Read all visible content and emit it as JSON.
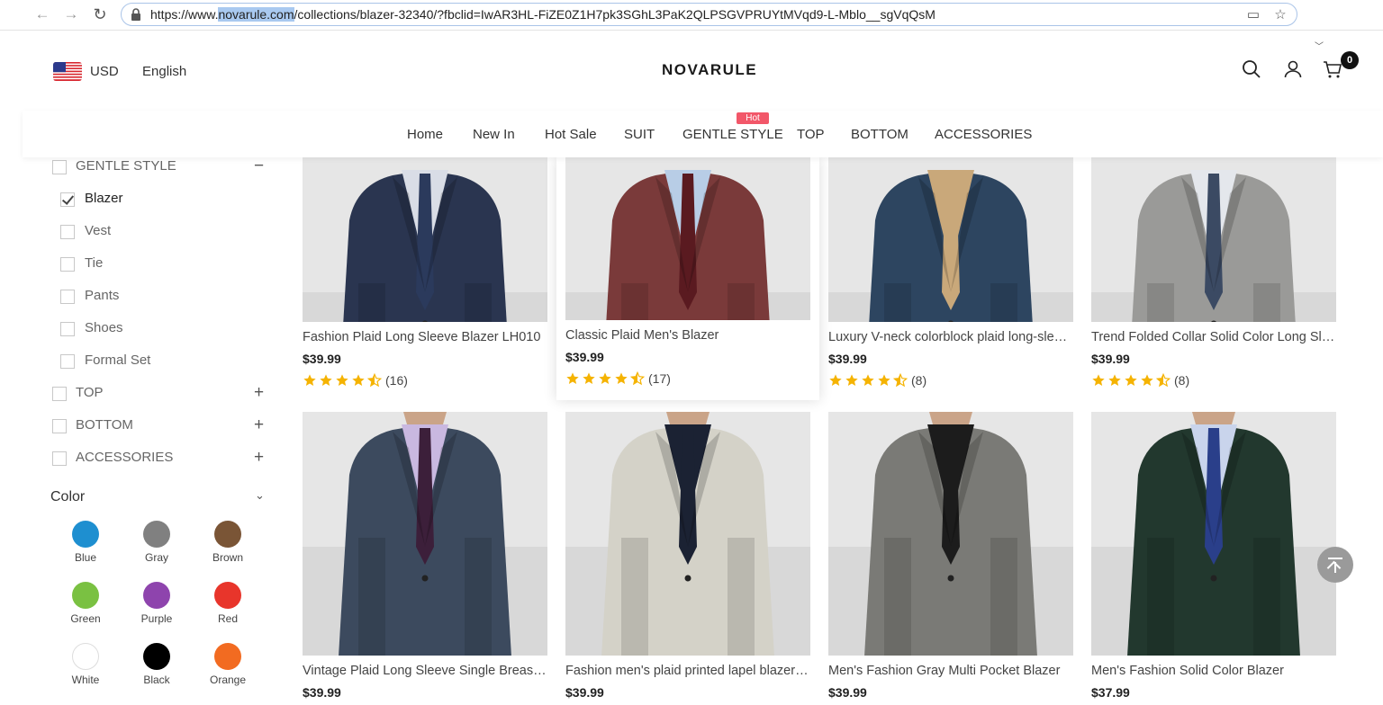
{
  "browser": {
    "url_pre": "https://www.",
    "url_host": "novarule.com",
    "url_post": "/collections/blazer-32340/?fbclid=IwAR3HL-FiZE0Z1H7pk3SGhL3PaK2QLPSGVPRUYtMVqd9-L-Mblo__sgVqQsM"
  },
  "header": {
    "currency": "USD",
    "language": "English",
    "logo": "NOVARULE",
    "cart_count": "0"
  },
  "menu": {
    "items": [
      "Home",
      "New In",
      "Hot Sale",
      "SUIT",
      "GENTLE STYLE",
      "TOP",
      "BOTTOM",
      "ACCESSORIES"
    ],
    "hot_badge": "Hot"
  },
  "sidebar": {
    "categories": [
      {
        "label": "GENTLE STYLE",
        "toggle": "−"
      },
      {
        "label": "Blazer"
      },
      {
        "label": "Vest"
      },
      {
        "label": "Tie"
      },
      {
        "label": "Pants"
      },
      {
        "label": "Shoes"
      },
      {
        "label": "Formal Set"
      },
      {
        "label": "TOP",
        "toggle": "+"
      },
      {
        "label": "BOTTOM",
        "toggle": "+"
      },
      {
        "label": "ACCESSORIES",
        "toggle": "+"
      }
    ],
    "color_title": "Color",
    "colors": [
      {
        "name": "Blue",
        "hex": "#1e8fd0"
      },
      {
        "name": "Gray",
        "hex": "#808080"
      },
      {
        "name": "Brown",
        "hex": "#7a5536"
      },
      {
        "name": "Green",
        "hex": "#7ac142"
      },
      {
        "name": "Purple",
        "hex": "#8e44ad"
      },
      {
        "name": "Red",
        "hex": "#e8352b"
      },
      {
        "name": "White",
        "hex": "#ffffff"
      },
      {
        "name": "Black",
        "hex": "#000000"
      },
      {
        "name": "Orange",
        "hex": "#f26b21"
      }
    ]
  },
  "products": [
    {
      "name": "Fashion Plaid Long Sleeve Blazer LH010",
      "price": "$39.99",
      "reviews": "(16)",
      "rating": 4.5,
      "jacket": "#2a3550",
      "inner": "#d9dde6",
      "tie": "#2b3a5c"
    },
    {
      "name": "Classic Plaid Men's Blazer",
      "price": "$39.99",
      "reviews": "(17)",
      "rating": 4.5,
      "jacket": "#7a3a3a",
      "inner": "#b8cde6",
      "tie": "#5a1a20"
    },
    {
      "name": "Luxury V-neck colorblock plaid long-sleeve blazer",
      "price": "$39.99",
      "reviews": "(8)",
      "rating": 4.5,
      "jacket": "#2d4560",
      "inner": "#c9a87a",
      "tie": "#c9a87a"
    },
    {
      "name": "Trend Folded Collar Solid Color Long Sleeve Blazer",
      "price": "$39.99",
      "reviews": "(8)",
      "rating": 4.5,
      "jacket": "#9a9a98",
      "inner": "#e4e7ec",
      "tie": "#3b4a63"
    },
    {
      "name": "Vintage Plaid Long Sleeve Single Breasted Blazer",
      "price": "$39.99",
      "jacket": "#3c4a5e",
      "inner": "#c9b8e0",
      "tie": "#3c1f3a"
    },
    {
      "name": "Fashion men's plaid printed lapel blazer jacket",
      "price": "$39.99",
      "jacket": "#d4d2c8",
      "inner": "#1b2233",
      "tie": "#1b2233"
    },
    {
      "name": "Men's Fashion Gray Multi Pocket Blazer",
      "price": "$39.99",
      "jacket": "#7a7a76",
      "inner": "#1c1c1c",
      "tie": "#1c1c1c"
    },
    {
      "name": "Men's Fashion Solid Color Blazer",
      "price": "$37.99",
      "jacket": "#22382e",
      "inner": "#c9d4ec",
      "tie": "#2a3f8a"
    }
  ]
}
